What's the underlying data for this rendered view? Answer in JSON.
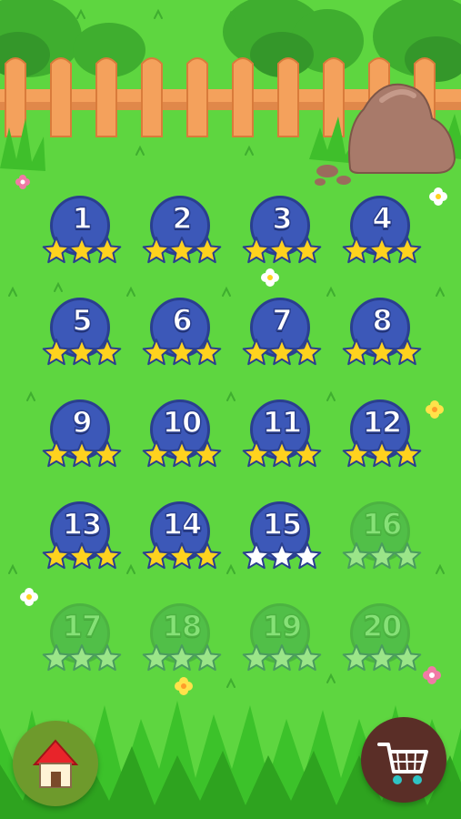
{
  "levels": [
    {
      "number": "1",
      "stars": 3,
      "unlocked": true
    },
    {
      "number": "2",
      "stars": 3,
      "unlocked": true
    },
    {
      "number": "3",
      "stars": 3,
      "unlocked": true
    },
    {
      "number": "4",
      "stars": 3,
      "unlocked": true
    },
    {
      "number": "5",
      "stars": 3,
      "unlocked": true
    },
    {
      "number": "6",
      "stars": 3,
      "unlocked": true
    },
    {
      "number": "7",
      "stars": 3,
      "unlocked": true
    },
    {
      "number": "8",
      "stars": 3,
      "unlocked": true
    },
    {
      "number": "9",
      "stars": 3,
      "unlocked": true
    },
    {
      "number": "10",
      "stars": 3,
      "unlocked": true
    },
    {
      "number": "11",
      "stars": 3,
      "unlocked": true
    },
    {
      "number": "12",
      "stars": 3,
      "unlocked": true
    },
    {
      "number": "13",
      "stars": 3,
      "unlocked": true
    },
    {
      "number": "14",
      "stars": 3,
      "unlocked": true
    },
    {
      "number": "15",
      "stars": 0,
      "unlocked": true
    },
    {
      "number": "16",
      "stars": 0,
      "unlocked": false
    },
    {
      "number": "17",
      "stars": 0,
      "unlocked": false
    },
    {
      "number": "18",
      "stars": 0,
      "unlocked": false
    },
    {
      "number": "19",
      "stars": 0,
      "unlocked": false
    },
    {
      "number": "20",
      "stars": 0,
      "unlocked": false
    }
  ],
  "max_stars": 3,
  "buttons": {
    "home": {
      "icon": "house-icon"
    },
    "shop": {
      "icon": "shopping-cart-icon"
    }
  },
  "colors": {
    "grass": "#5ed640",
    "badge": "#3c58b8",
    "badge_locked": "#3e9a55",
    "star_filled": "#ffd21e",
    "star_empty": "#ffffff",
    "fence": "#f4a15c",
    "rock": "#a87a6a",
    "home_button": "#6e9a2c",
    "shop_button": "#5a2e27"
  }
}
